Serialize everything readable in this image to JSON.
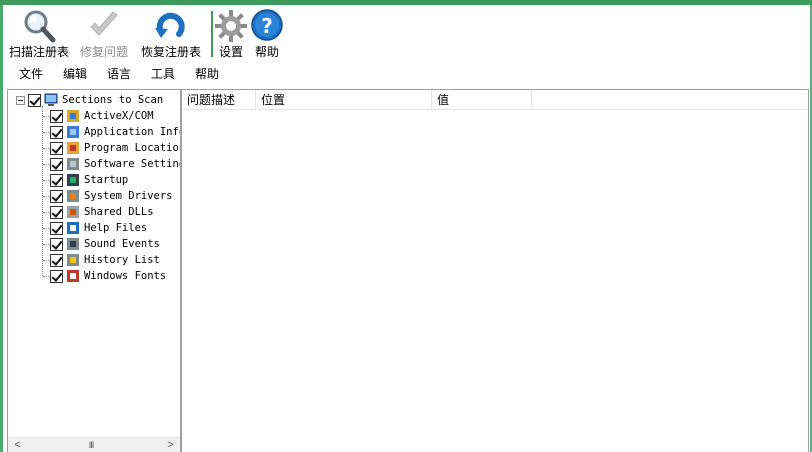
{
  "toolbar": {
    "scan_label": "扫描注册表",
    "fix_label": "修复问题",
    "restore_label": "恢复注册表",
    "settings_label": "设置",
    "help_label": "帮助"
  },
  "menu": {
    "file": "文件",
    "edit": "编辑",
    "language": "语言",
    "tools": "工具",
    "help": "帮助"
  },
  "tree": {
    "root": "Sections to Scan",
    "items": [
      {
        "label": "ActiveX/COM",
        "icon": "activex-icon"
      },
      {
        "label": "Application Info",
        "icon": "application-info-icon"
      },
      {
        "label": "Program Locations",
        "icon": "program-locations-icon"
      },
      {
        "label": "Software Settings",
        "icon": "software-settings-icon"
      },
      {
        "label": "Startup",
        "icon": "startup-icon"
      },
      {
        "label": "System Drivers",
        "icon": "system-drivers-icon"
      },
      {
        "label": "Shared DLLs",
        "icon": "shared-dlls-icon"
      },
      {
        "label": "Help Files",
        "icon": "help-files-icon"
      },
      {
        "label": "Sound Events",
        "icon": "sound-events-icon"
      },
      {
        "label": "History List",
        "icon": "history-list-icon"
      },
      {
        "label": "Windows Fonts",
        "icon": "windows-fonts-icon"
      }
    ]
  },
  "scrollbar": {
    "left_arrow": "<",
    "right_arrow": ">",
    "grip": "III"
  },
  "list": {
    "columns": [
      "问题描述",
      "位置",
      "值"
    ]
  },
  "colors": {
    "accent_green": "#3e9b5b",
    "help_blue": "#1f6fc1"
  }
}
